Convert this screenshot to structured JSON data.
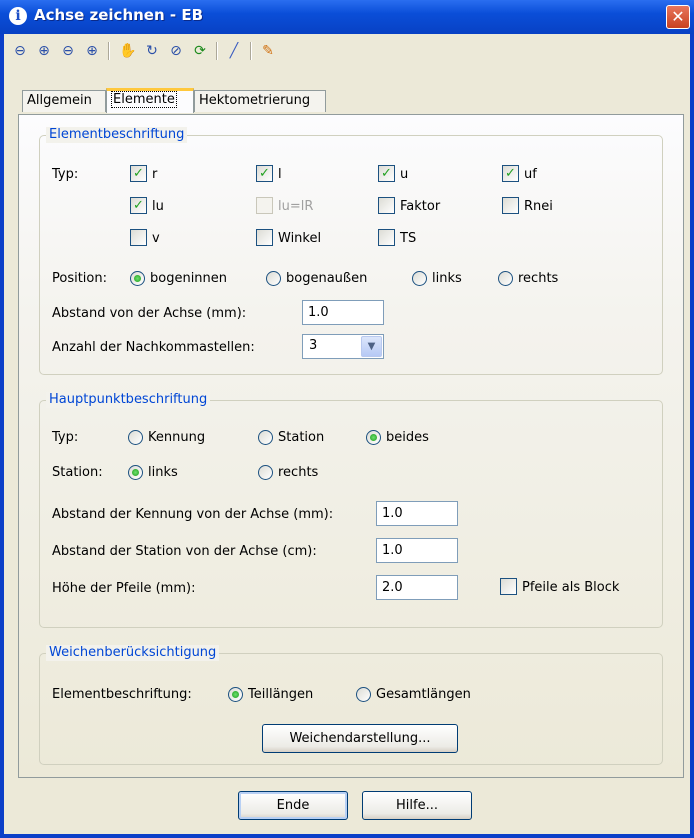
{
  "window": {
    "title": "Achse zeichnen - EB",
    "close_glyph": "✕"
  },
  "toolbar": {
    "icons": [
      "zoom-window-icon",
      "zoom-in-icon",
      "zoom-out-icon",
      "zoom-all-icon",
      "pan-icon",
      "rotate-icon",
      "zoom-previous-icon",
      "refresh-icon",
      "brush-icon",
      "pencil-icon"
    ]
  },
  "tabs": {
    "allgemein": "Allgemein",
    "elemente": "Elemente",
    "hektometrierung": "Hektometrierung"
  },
  "elementbeschriftung": {
    "title": "Elementbeschriftung",
    "typ_label": "Typ:",
    "checkboxes": [
      {
        "label": "r",
        "checked": true
      },
      {
        "label": "l",
        "checked": true
      },
      {
        "label": "u",
        "checked": true
      },
      {
        "label": "uf",
        "checked": true
      },
      {
        "label": "lu",
        "checked": true
      },
      {
        "label": "lu=lR",
        "checked": false,
        "disabled": true
      },
      {
        "label": "Faktor",
        "checked": false
      },
      {
        "label": "Rnei",
        "checked": false
      },
      {
        "label": "v",
        "checked": false
      },
      {
        "label": "Winkel",
        "checked": false
      },
      {
        "label": "TS",
        "checked": false
      }
    ],
    "position_label": "Position:",
    "position_options": [
      "bogeninnen",
      "bogenaußen",
      "links",
      "rechts"
    ],
    "position_selected": "bogeninnen",
    "abstand_label": "Abstand von der Achse (mm):",
    "abstand_value": "1.0",
    "nachkomma_label": "Anzahl der Nachkommastellen:",
    "nachkomma_value": "3"
  },
  "hauptpunktbeschriftung": {
    "title": "Hauptpunktbeschriftung",
    "typ_label": "Typ:",
    "typ_options": [
      "Kennung",
      "Station",
      "beides"
    ],
    "typ_selected": "beides",
    "station_label": "Station:",
    "station_options": [
      "links",
      "rechts"
    ],
    "station_selected": "links",
    "abstand_kennung_label": "Abstand der Kennung von der Achse (mm):",
    "abstand_kennung_value": "1.0",
    "abstand_station_label": "Abstand der Station von der Achse (cm):",
    "abstand_station_value": "1.0",
    "hoehe_label": "Höhe der Pfeile (mm):",
    "hoehe_value": "2.0",
    "pfeile_block_label": "Pfeile als Block",
    "pfeile_block_checked": false
  },
  "weichen": {
    "title": "Weichenberücksichtigung",
    "label": "Elementbeschriftung:",
    "options": [
      "Teillängen",
      "Gesamtlängen"
    ],
    "selected": "Teillängen",
    "button": "Weichendarstellung..."
  },
  "footer": {
    "ende": "Ende",
    "hilfe": "Hilfe..."
  }
}
